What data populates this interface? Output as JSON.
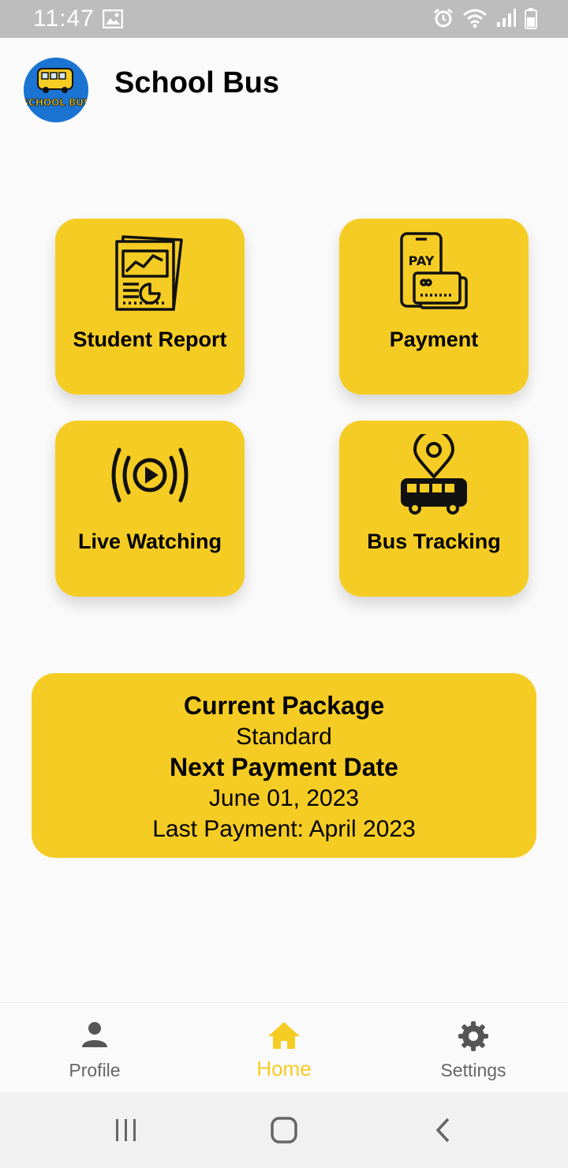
{
  "status_bar": {
    "time": "11:47"
  },
  "app": {
    "title": "School Bus",
    "logo_text": "SCHOOL BUS"
  },
  "tiles": [
    {
      "label": "Student Report",
      "icon": "report-chart-icon"
    },
    {
      "label": "Payment",
      "icon": "pay-phone-card-icon"
    },
    {
      "label": "Live Watching",
      "icon": "live-stream-icon"
    },
    {
      "label": "Bus Tracking",
      "icon": "bus-location-icon"
    }
  ],
  "package": {
    "current_heading": "Current Package",
    "current_value": "Standard",
    "next_heading": "Next Payment Date",
    "next_value": "June 01, 2023",
    "last_payment": "Last Payment: April 2023"
  },
  "bottom_nav": {
    "items": [
      {
        "label": "Profile",
        "icon": "person-icon"
      },
      {
        "label": "Home",
        "icon": "home-icon",
        "active": true
      },
      {
        "label": "Settings",
        "icon": "gear-icon"
      }
    ]
  },
  "colors": {
    "accent": "#f5cc24",
    "status_bar": "#bdbdbd",
    "logo_bg": "#1b74d1"
  }
}
